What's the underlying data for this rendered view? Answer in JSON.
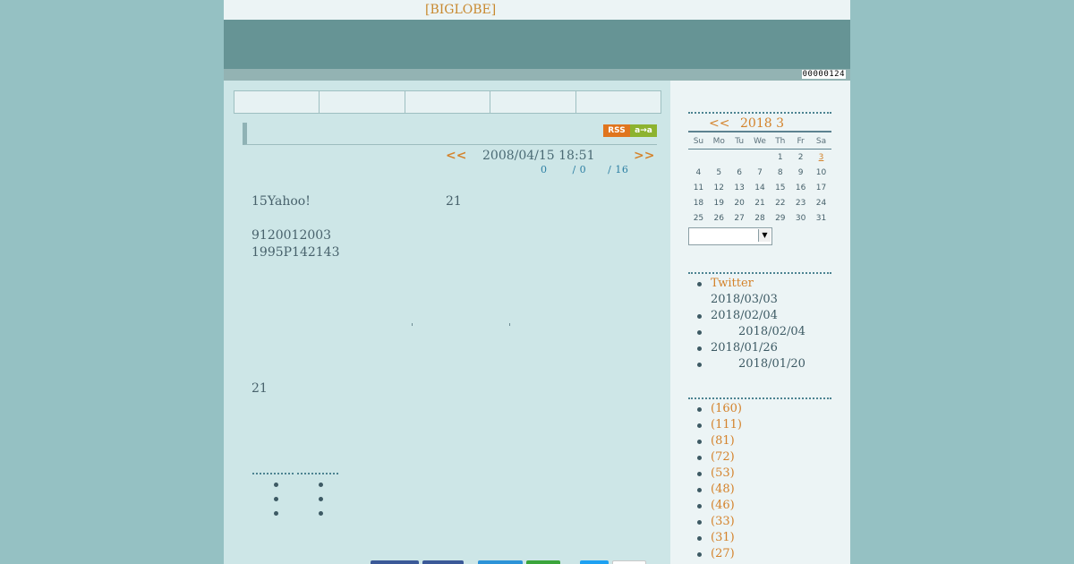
{
  "header": {
    "site_link": "[BIGLOBE]",
    "counter": "00000124"
  },
  "post": {
    "prev_label": "<<",
    "next_label": ">>",
    "date": "2008/04/15 18:51",
    "stats": "0       / 0      / 16",
    "body": {
      "line1a": "15Yahoo!",
      "line1b": "21",
      "line2": "9120012003",
      "line3": "1995P142143",
      "line4": "21"
    }
  },
  "calendar": {
    "prev_label": "<<",
    "title": "2018 3",
    "weekdays": [
      "Su",
      "Mo",
      "Tu",
      "We",
      "Th",
      "Fr",
      "Sa"
    ],
    "weeks": [
      [
        "",
        "",
        "",
        "",
        "1",
        "2",
        "3"
      ],
      [
        "4",
        "5",
        "6",
        "7",
        "8",
        "9",
        "10"
      ],
      [
        "11",
        "12",
        "13",
        "14",
        "15",
        "16",
        "17"
      ],
      [
        "18",
        "19",
        "20",
        "21",
        "22",
        "23",
        "24"
      ],
      [
        "25",
        "26",
        "27",
        "28",
        "29",
        "30",
        "31"
      ]
    ],
    "linked_day": "3"
  },
  "recent_posts": [
    {
      "title": "Twitter",
      "date": "2018/03/03"
    },
    {
      "title": "",
      "date": "2018/02/04"
    },
    {
      "title": "",
      "date": "2018/02/04"
    },
    {
      "title": "",
      "date": "2018/01/26"
    },
    {
      "title": "",
      "date": "2018/01/20"
    }
  ],
  "categories": [
    {
      "count": "(160)"
    },
    {
      "count": "(111)"
    },
    {
      "count": "(81)"
    },
    {
      "count": "(72)"
    },
    {
      "count": "(53)"
    },
    {
      "count": "(48)"
    },
    {
      "count": "(46)"
    },
    {
      "count": "(33)"
    },
    {
      "count": "(31)"
    },
    {
      "count": "(27)"
    }
  ],
  "colors": {
    "background": "#95c1c3",
    "content": "#cde6e7",
    "sidebar": "#ecf4f5",
    "banner": "#669495",
    "link": "#d4822a",
    "text": "#3d5a64"
  },
  "icons": {
    "rss": "rss-feed-icon",
    "feed_reader": "feed-reader-icon"
  }
}
